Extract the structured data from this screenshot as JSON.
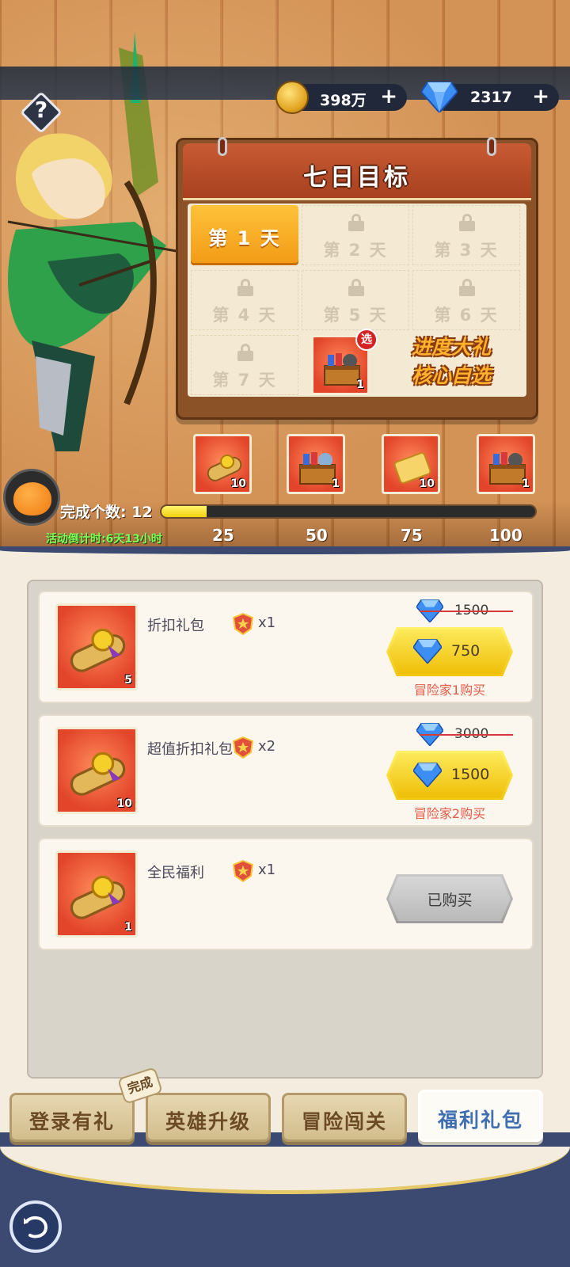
{
  "header": {
    "help_label": "?",
    "gold_value": "398万",
    "gem_value": "2317",
    "plus_label": "+"
  },
  "board": {
    "title": "七日目标",
    "days": [
      {
        "label": "第 1 天",
        "locked": false
      },
      {
        "label": "第 2 天",
        "locked": true
      },
      {
        "label": "第 3 天",
        "locked": true
      },
      {
        "label": "第 4 天",
        "locked": true
      },
      {
        "label": "第 5 天",
        "locked": true
      },
      {
        "label": "第 6 天",
        "locked": true
      },
      {
        "label": "第 7 天",
        "locked": true
      }
    ],
    "prize_count": "1",
    "select_badge": "选",
    "big_gift_line1": "进度大礼",
    "big_gift_line2": "核心自选"
  },
  "milestones": [
    {
      "icon": "scroll-icon",
      "count": "10"
    },
    {
      "icon": "chest-icon",
      "count": "1"
    },
    {
      "icon": "ticket-icon",
      "count": "10"
    },
    {
      "icon": "chest-icon",
      "count": "1"
    }
  ],
  "progress": {
    "label": "完成个数:",
    "count": "12",
    "fraction": 0.12,
    "countdown": "活动倒计时:6天13小时",
    "ticks": [
      "25",
      "50",
      "75",
      "100"
    ]
  },
  "offers": [
    {
      "name": "折扣礼包",
      "qty": "x1",
      "item_count": "5",
      "old_price": "1500",
      "price": "750",
      "requirement": "冒险家1购买",
      "purchased": false
    },
    {
      "name": "超值折扣礼包",
      "qty": "x2",
      "item_count": "10",
      "old_price": "3000",
      "price": "1500",
      "requirement": "冒险家2购买",
      "purchased": false
    },
    {
      "name": "全民福利",
      "qty": "x1",
      "item_count": "1",
      "button_label": "已购买",
      "purchased": true
    }
  ],
  "tabs": [
    {
      "label": "登录有礼",
      "active": false
    },
    {
      "label": "英雄升级",
      "active": false
    },
    {
      "label": "冒险闯关",
      "active": false
    },
    {
      "label": "福利礼包",
      "active": true
    }
  ],
  "done_badge": "完成",
  "colors": {
    "accent_yellow": "#f3d10f",
    "price_red": "#e45a4a",
    "active_tab_text": "#3f6fb0",
    "countdown_green": "#7cff5a"
  }
}
